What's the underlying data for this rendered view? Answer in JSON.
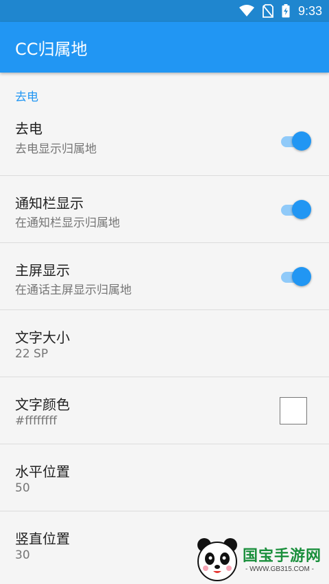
{
  "status_bar": {
    "time": "9:33",
    "icons": [
      "wifi-icon",
      "no-sim-icon",
      "battery-charging-icon"
    ]
  },
  "app_bar": {
    "title": "CC归属地"
  },
  "category": {
    "label": "去电"
  },
  "prefs": [
    {
      "title": "去电",
      "summary": "去电显示归属地",
      "control": "switch",
      "checked": true
    },
    {
      "title": "通知栏显示",
      "summary": "在通知栏显示归属地",
      "control": "switch",
      "checked": true
    },
    {
      "title": "主屏显示",
      "summary": "在通话主屏显示归属地",
      "control": "switch",
      "checked": true
    },
    {
      "title": "文字大小",
      "summary": "22 SP"
    },
    {
      "title": "文字颜色",
      "summary": "#ffffffff",
      "control": "color-swatch",
      "color": "#ffffff"
    },
    {
      "title": "水平位置",
      "summary": "50"
    },
    {
      "title": "竖直位置",
      "summary": "30"
    }
  ],
  "watermark": {
    "brand": "国宝手游网",
    "url": "- WWW.GB315.COM -"
  },
  "colors": {
    "status_bar": "#1f86cf",
    "app_bar": "#2196f3",
    "accent": "#2196f3",
    "switch_track": "#90caf9"
  }
}
